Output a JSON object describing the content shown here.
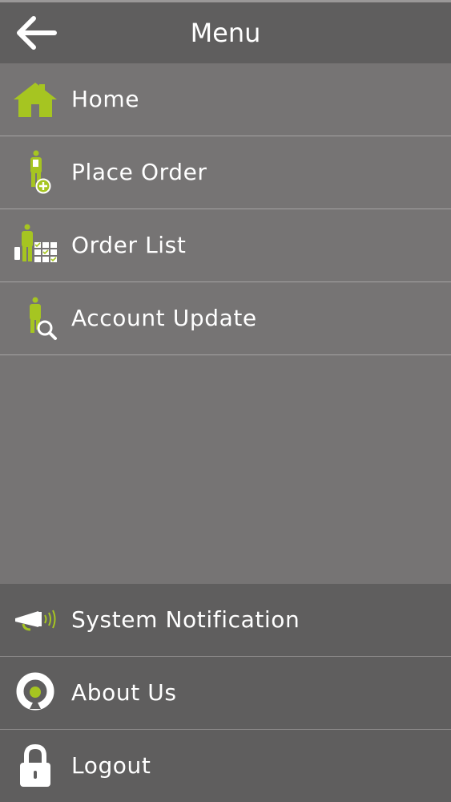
{
  "header": {
    "title": "Menu",
    "back_icon": "arrow-left-icon"
  },
  "colors": {
    "accent": "#a6c521",
    "panel": "#767474",
    "panel_dark": "#5f5e5e",
    "text": "#ffffff"
  },
  "menu": {
    "items": [
      {
        "label": "Home",
        "icon": "home-icon"
      },
      {
        "label": "Place Order",
        "icon": "place-order-icon"
      },
      {
        "label": "Order List",
        "icon": "order-list-icon"
      },
      {
        "label": "Account Update",
        "icon": "account-update-icon"
      }
    ]
  },
  "footer_menu": {
    "items": [
      {
        "label": "System Notification",
        "icon": "megaphone-icon"
      },
      {
        "label": "About Us",
        "icon": "about-logo-icon"
      },
      {
        "label": "Logout",
        "icon": "lock-icon"
      }
    ]
  }
}
